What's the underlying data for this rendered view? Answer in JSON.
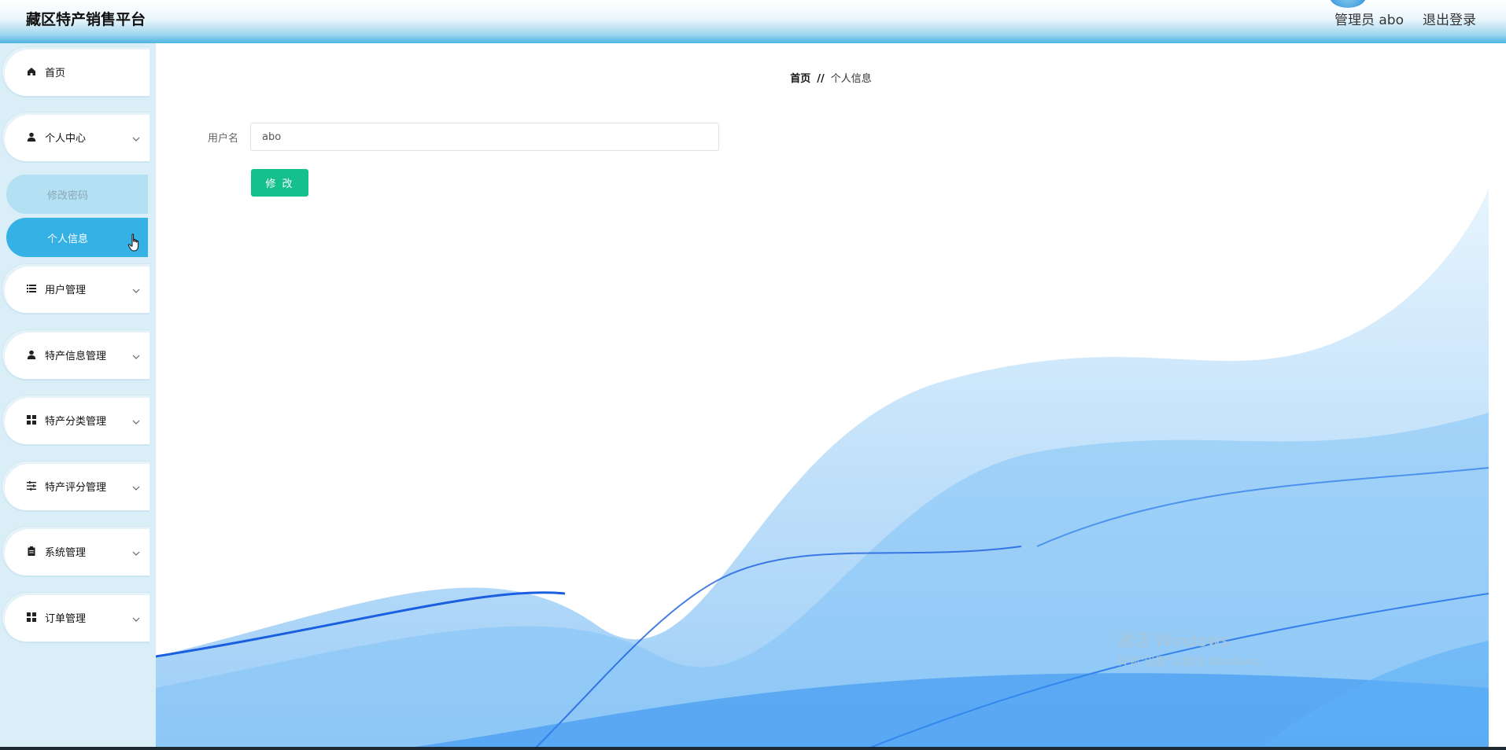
{
  "header": {
    "brand": "藏区特产销售平台",
    "user_label": "管理员 abo",
    "logout_label": "退出登录"
  },
  "sidebar": {
    "items": [
      {
        "label": "首页",
        "icon": "home-icon"
      },
      {
        "label": "个人中心",
        "icon": "user-icon",
        "expanded": true,
        "children": [
          {
            "label": "修改密码"
          },
          {
            "label": "个人信息",
            "active": true
          }
        ]
      },
      {
        "label": "用户管理",
        "icon": "list-icon"
      },
      {
        "label": "特产信息管理",
        "icon": "user-icon"
      },
      {
        "label": "特产分类管理",
        "icon": "grid-icon"
      },
      {
        "label": "特产评分管理",
        "icon": "sliders-icon"
      },
      {
        "label": "系统管理",
        "icon": "clipboard-icon"
      },
      {
        "label": "订单管理",
        "icon": "grid-icon"
      }
    ]
  },
  "breadcrumb": {
    "home": "首页",
    "separator": "//",
    "current": "个人信息"
  },
  "form": {
    "username_label": "用户名",
    "username_value": "abo",
    "submit_label": "修 改"
  },
  "watermark": {
    "line1": "激活 Windows",
    "line2": "转到\"设置\"以激活 Windows。"
  },
  "colors": {
    "accent": "#36b1e6",
    "button": "#14c08c",
    "sidebar_bg": "#d9eef6"
  }
}
